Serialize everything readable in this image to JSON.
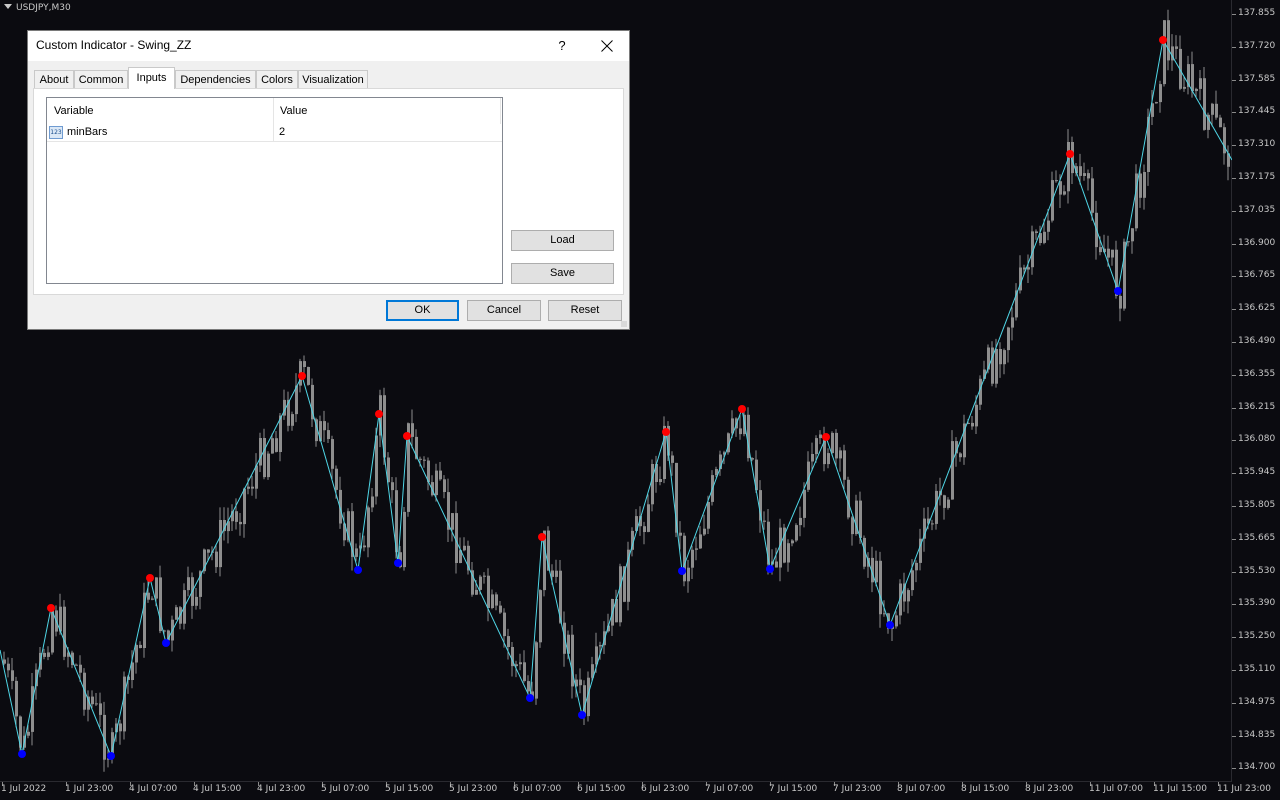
{
  "chart": {
    "symbol": "USDJPY,M30",
    "price_labels": [
      "137.855",
      "137.720",
      "137.585",
      "137.445",
      "137.310",
      "137.175",
      "137.035",
      "136.900",
      "136.765",
      "136.625",
      "136.490",
      "136.355",
      "136.215",
      "136.080",
      "135.945",
      "135.805",
      "135.665",
      "135.530",
      "135.390",
      "135.250",
      "135.110",
      "134.975",
      "134.835",
      "134.700"
    ],
    "time_labels": [
      "1 Jul 2022",
      "1 Jul 23:00",
      "4 Jul 07:00",
      "4 Jul 15:00",
      "4 Jul 23:00",
      "5 Jul 07:00",
      "5 Jul 15:00",
      "5 Jul 23:00",
      "6 Jul 07:00",
      "6 Jul 15:00",
      "6 Jul 23:00",
      "7 Jul 07:00",
      "7 Jul 15:00",
      "7 Jul 23:00",
      "8 Jul 07:00",
      "8 Jul 15:00",
      "8 Jul 23:00",
      "11 Jul 07:00",
      "11 Jul 15:00",
      "11 Jul 23:00"
    ],
    "colors": {
      "background": "#0b0b10",
      "candles": "#8e8e8e",
      "zigzag": "#4fd6e6",
      "swing_high": "#ff0000",
      "swing_low": "#0000ff"
    }
  },
  "dialog": {
    "title": "Custom Indicator - Swing_ZZ",
    "help_label": "?",
    "close_icon": "close-icon",
    "tabs": [
      {
        "label": "About",
        "active": false
      },
      {
        "label": "Common",
        "active": false
      },
      {
        "label": "Inputs",
        "active": true
      },
      {
        "label": "Dependencies",
        "active": false
      },
      {
        "label": "Colors",
        "active": false
      },
      {
        "label": "Visualization",
        "active": false
      }
    ],
    "grid": {
      "col_variable": "Variable",
      "col_value": "Value",
      "rows": [
        {
          "icon": "integer-param-icon",
          "icon_text": "123",
          "name": "minBars",
          "value": "2"
        }
      ]
    },
    "load_label": "Load",
    "save_label": "Save",
    "ok_label": "OK",
    "cancel_label": "Cancel",
    "reset_label": "Reset"
  }
}
